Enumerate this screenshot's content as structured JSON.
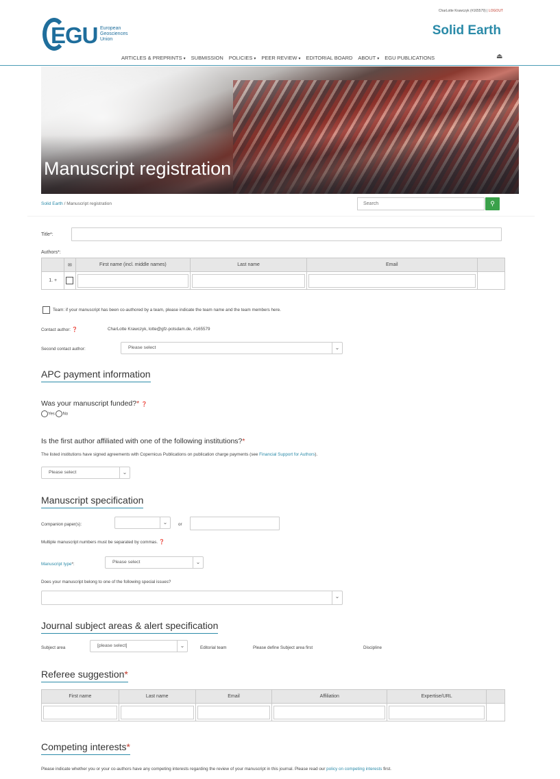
{
  "header": {
    "user_name": "CharLotte Krawczyk",
    "user_id": "(#165579)",
    "logout_label": "LOGOUT",
    "logo_text": "EGU",
    "logo_sub": [
      "European",
      "Geosciences",
      "Union"
    ],
    "journal_title": "Solid Earth",
    "nav": [
      {
        "label": "ARTICLES & PREPRINTS",
        "dropdown": true
      },
      {
        "label": "SUBMISSION",
        "dropdown": false
      },
      {
        "label": "POLICIES",
        "dropdown": true
      },
      {
        "label": "PEER REVIEW",
        "dropdown": true
      },
      {
        "label": "EDITORIAL BOARD",
        "dropdown": false
      },
      {
        "label": "ABOUT",
        "dropdown": true
      },
      {
        "label": "EGU PUBLICATIONS",
        "dropdown": false
      }
    ]
  },
  "hero": {
    "title": "Manuscript registration"
  },
  "breadcrumb": {
    "root": "Solid Earth",
    "separator": "/",
    "current": "Manuscript registration"
  },
  "search": {
    "placeholder": "Search"
  },
  "form": {
    "title_label": "Title",
    "title_req": "*:",
    "authors_label": "Authors",
    "authors_req": "*:",
    "authors_columns": [
      "First name (incl. middle names)",
      "Last name",
      "Email"
    ],
    "authors_row_index": "1.",
    "authors_row_add": "+",
    "team_text": "Team: if your manuscript has been co-authored by a team, please indicate the team name and the team members here.",
    "contact_label": "Contact author:",
    "contact_value": "CharLotte Krawczyk, lotte@gfz-potsdam.de, #165579",
    "second_contact_label": "Second contact author:",
    "second_contact_value": "Please select"
  },
  "apc": {
    "heading": "APC payment information",
    "funded_question": "Was your manuscript funded?",
    "funded_req": "*",
    "yes": "Yes",
    "no": "No",
    "affiliation_question": "Is the first author affiliated with one of the following institutions?",
    "affiliation_req": "*",
    "affiliation_note_pre": "The listed institutions have signed agreements with Copernicus Publications on publication charge payments (see ",
    "affiliation_note_link": "Financial Support for Authors",
    "affiliation_note_post": ").",
    "affiliation_select": "Please select"
  },
  "spec": {
    "heading": "Manuscript specification",
    "companion_label": "Companion paper(s):",
    "or_label": "or",
    "multiple_note": "Multiple manuscript numbers must be separated by commas.",
    "type_label": "Manuscript type",
    "type_req": "*:",
    "type_value": "Please select",
    "special_issue_question": "Does your manuscript belong to one of the following special issues?"
  },
  "subject": {
    "heading": "Journal subject areas & alert specification",
    "area_label": "Subject area",
    "area_value": "[please select]",
    "editorial_label": "Editorial team",
    "editorial_value": "Please define Subject area first",
    "discipline_label": "Discipline"
  },
  "referee": {
    "heading": "Referee suggestion",
    "req": "*",
    "columns": [
      "First name",
      "Last name",
      "Email",
      "Affiliation",
      "Expertise/URL"
    ]
  },
  "competing": {
    "heading": "Competing interests",
    "req": "*",
    "note_pre": "Please indicate whether you or your co-authors have any competing interests regarding the review of your manuscript in this journal. Please read our ",
    "note_link": "policy on competing interests",
    "note_post": " first."
  }
}
